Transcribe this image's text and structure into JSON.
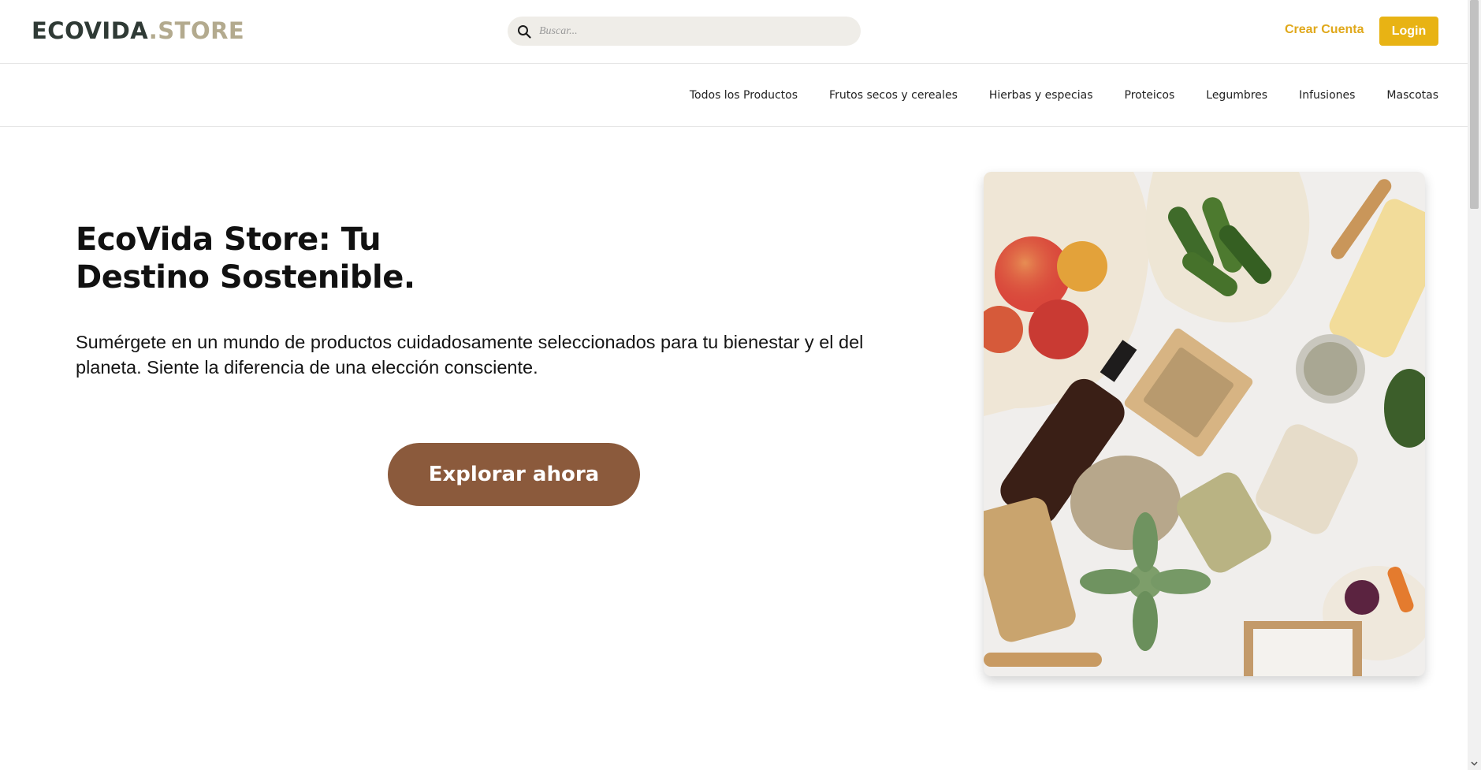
{
  "header": {
    "logo_part1": "ECOVIDA",
    "logo_part2": ".STORE",
    "search_placeholder": "Buscar...",
    "create_account_label": "Crear Cuenta",
    "login_label": "Login"
  },
  "nav": {
    "items": [
      "Todos los Productos",
      "Frutos secos y cereales",
      "Hierbas y especias",
      "Proteicos",
      "Legumbres",
      "Infusiones",
      "Mascotas"
    ]
  },
  "hero": {
    "title_line1": "EcoVida Store: Tu",
    "title_line2": "Destino Sostenible.",
    "text": "Sumérgete en un mundo de productos cuidadosamente seleccionados para tu bienestar y el del planeta. Siente la diferencia de una elección consciente.",
    "cta_label": "Explorar ahora"
  },
  "colors": {
    "accent": "#e8b314",
    "cta": "#8b5a3c",
    "logo_dark": "#2f3a35",
    "logo_light": "#b3aa8e",
    "search_bg": "#efede8"
  },
  "icons": {
    "search": "search-icon",
    "scroll_down": "chevron-down-icon"
  }
}
